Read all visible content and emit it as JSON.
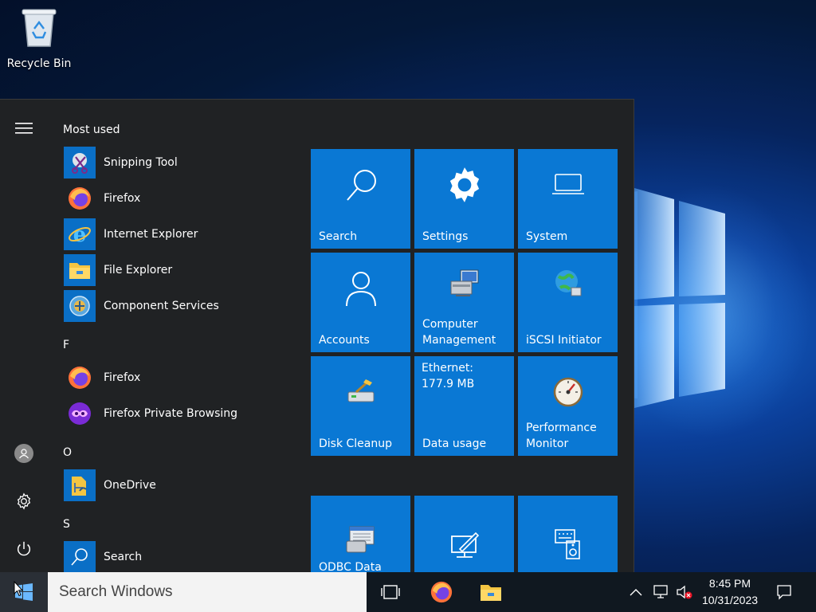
{
  "desktop": {
    "icons": [
      {
        "label": "Recycle Bin",
        "icon": "recycle-bin-icon"
      }
    ]
  },
  "start_menu": {
    "rail": {
      "menu_icon": "hamburger-icon",
      "user_icon": "user-icon",
      "settings_icon": "gear-icon",
      "power_icon": "power-icon"
    },
    "most_used_header": "Most used",
    "most_used": [
      {
        "label": "Snipping Tool",
        "icon": "snipping-tool-icon"
      },
      {
        "label": "Firefox",
        "icon": "firefox-icon"
      },
      {
        "label": "Internet Explorer",
        "icon": "internet-explorer-icon"
      },
      {
        "label": "File Explorer",
        "icon": "file-explorer-icon"
      },
      {
        "label": "Component Services",
        "icon": "component-services-icon"
      }
    ],
    "groups": [
      {
        "letter": "F",
        "items": [
          {
            "label": "Firefox",
            "icon": "firefox-icon"
          },
          {
            "label": "Firefox Private Browsing",
            "icon": "firefox-private-icon"
          }
        ]
      },
      {
        "letter": "O",
        "items": [
          {
            "label": "OneDrive",
            "icon": "onedrive-icon"
          }
        ]
      },
      {
        "letter": "S",
        "items": [
          {
            "label": "Search",
            "icon": "search-icon"
          }
        ]
      }
    ],
    "tiles": [
      {
        "label": "Search",
        "icon": "search-icon"
      },
      {
        "label": "Settings",
        "icon": "gear-icon"
      },
      {
        "label": "System",
        "icon": "laptop-icon"
      },
      {
        "label": "Accounts",
        "icon": "user-icon"
      },
      {
        "label": "Computer Management",
        "icon": "computer-management-icon"
      },
      {
        "label": "iSCSI Initiator",
        "icon": "globe-network-icon"
      },
      {
        "label": "Disk Cleanup",
        "icon": "disk-cleanup-icon"
      },
      {
        "label": "Data usage",
        "top_text": "Ethernet: 177.9 MB"
      },
      {
        "label": "Performance Monitor",
        "icon": "gauge-icon"
      },
      {
        "label": "ODBC Data",
        "icon": "odbc-icon"
      },
      {
        "label": "",
        "icon": "pen-screen-icon"
      },
      {
        "label": "",
        "icon": "keyboard-speaker-icon"
      }
    ],
    "tile_color": "#0a78d4",
    "background_color": "#202224"
  },
  "taskbar": {
    "search_placeholder": "Search Windows",
    "pinned": [
      "task-view-icon",
      "firefox-icon",
      "file-explorer-icon"
    ],
    "tray": [
      "chevron-up-icon",
      "network-icon",
      "volume-muted-icon"
    ],
    "time": "8:45 PM",
    "date": "10/31/2023",
    "notification_icon": "action-center-icon"
  }
}
